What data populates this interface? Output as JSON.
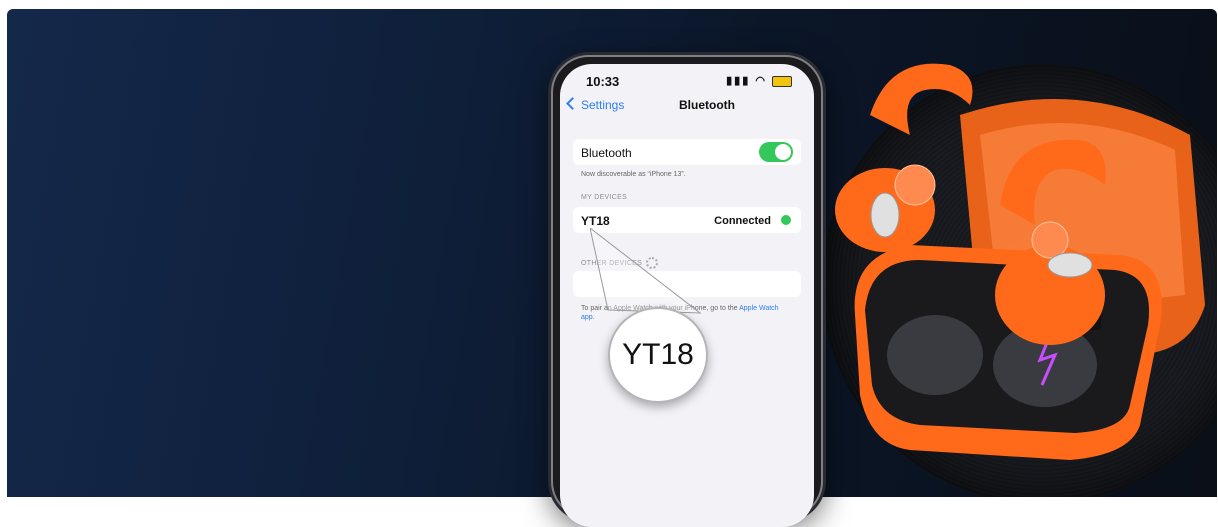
{
  "phone": {
    "status_time": "10:33",
    "nav_back": "Settings",
    "nav_title": "Bluetooth",
    "bluetooth_label": "Bluetooth",
    "bluetooth_on": true,
    "discoverable_note": "Now discoverable as “iPhone 13”.",
    "my_devices_header": "MY DEVICES",
    "device_name": "YT18",
    "device_status": "Connected",
    "other_devices_header": "OTHER DEVICES",
    "pair_text": "To pair an Apple Watch with your iPhone, go to the",
    "pair_link": "Apple Watch app."
  },
  "magnifier_label": "YT18",
  "colors": {
    "accent_blue": "#2f7df6",
    "toggle_green": "#34c759",
    "earbud_orange": "#ff6a1a",
    "background_navy": "#0f1f3a"
  }
}
